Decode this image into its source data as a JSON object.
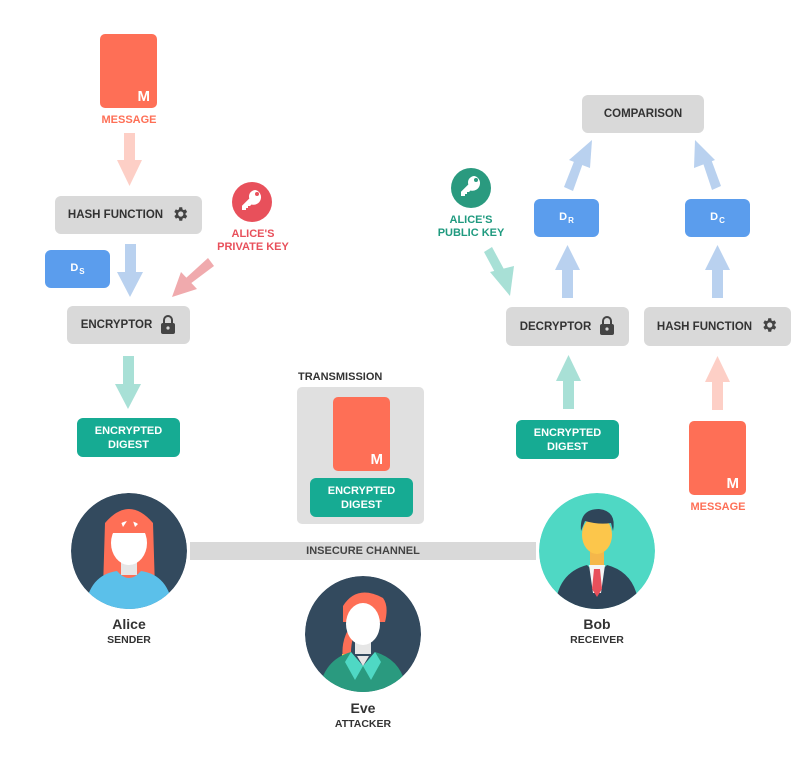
{
  "sender_side": {
    "message_letter": "M",
    "message_label": "MESSAGE",
    "hash_function": "HASH FUNCTION",
    "digest_main": "D",
    "digest_sub": "S",
    "private_key_label_line1": "ALICE'S",
    "private_key_label_line2": "PRIVATE KEY",
    "encryptor": "ENCRYPTOR",
    "encrypted_digest_line1": "ENCRYPTED",
    "encrypted_digest_line2": "DIGEST"
  },
  "transmission": {
    "title": "TRANSMISSION",
    "message_letter": "M",
    "encrypted_digest_line1": "ENCRYPTED",
    "encrypted_digest_line2": "DIGEST"
  },
  "receiver_side": {
    "comparison": "COMPARISON",
    "public_key_label_line1": "ALICE'S",
    "public_key_label_line2": "PUBLIC KEY",
    "digest_r_main": "D",
    "digest_r_sub": "R",
    "digest_c_main": "D",
    "digest_c_sub": "C",
    "decryptor": "DECRYPTOR",
    "hash_function": "HASH FUNCTION",
    "encrypted_digest_line1": "ENCRYPTED",
    "encrypted_digest_line2": "DIGEST",
    "message_letter": "M",
    "message_label": "MESSAGE"
  },
  "channel": {
    "label": "INSECURE CHANNEL"
  },
  "people": {
    "alice": {
      "name": "Alice",
      "role": "SENDER"
    },
    "bob": {
      "name": "Bob",
      "role": "RECEIVER"
    },
    "eve": {
      "name": "Eve",
      "role": "ATTACKER"
    }
  },
  "colors": {
    "message": "#fe6f56",
    "digest_blue": "#5b9ded",
    "encrypted_teal": "#16ab93",
    "box_gray": "#d9d9d9",
    "private_key_red": "#e8505b",
    "public_key_green": "#2a9a7f"
  }
}
